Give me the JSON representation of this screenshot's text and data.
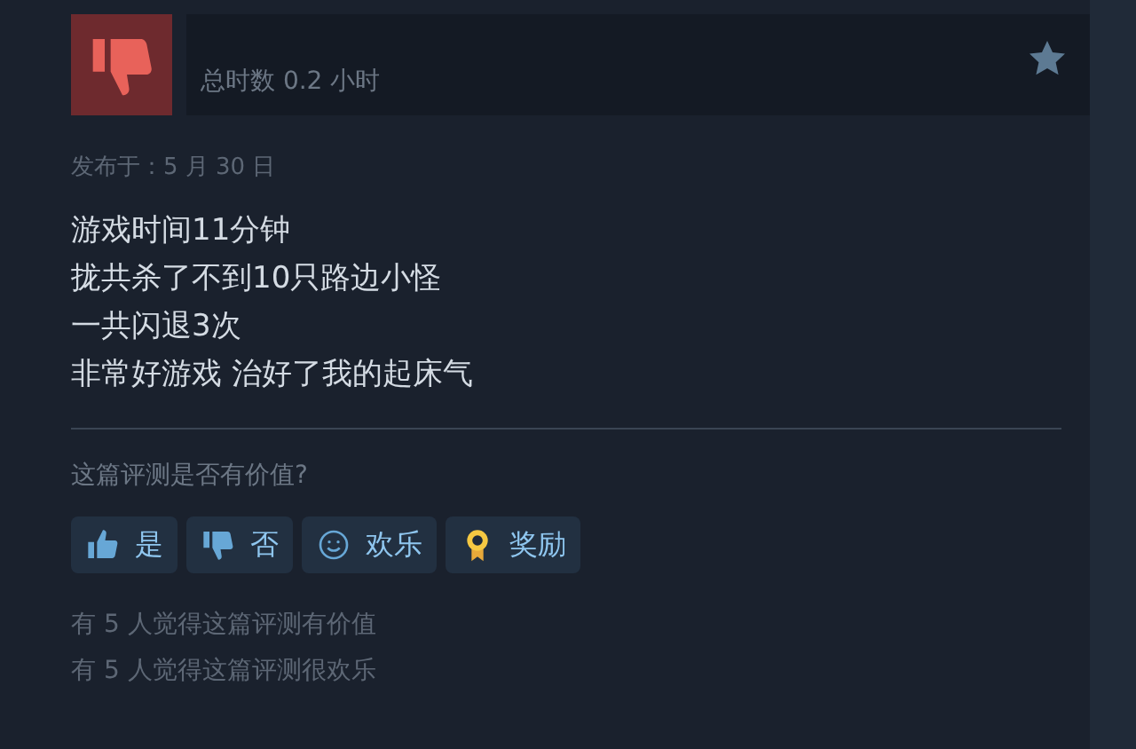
{
  "review": {
    "recommended": false,
    "playtime": "总时数 0.2 小时",
    "posted": "发布于：5 月 30 日",
    "body": [
      "游戏时间11分钟",
      "拢共杀了不到10只路边小怪",
      "一共闪退3次",
      "非常好游戏 治好了我的起床气"
    ]
  },
  "helpful": {
    "question": "这篇评测是否有价值?",
    "buttons": [
      {
        "kind": "yes",
        "label": "是"
      },
      {
        "kind": "no",
        "label": "否"
      },
      {
        "kind": "funny",
        "label": "欢乐"
      },
      {
        "kind": "award",
        "label": "奖励"
      }
    ],
    "counts": [
      "有 5 人觉得这篇评测有价值",
      "有 5 人觉得这篇评测很欢乐"
    ]
  }
}
